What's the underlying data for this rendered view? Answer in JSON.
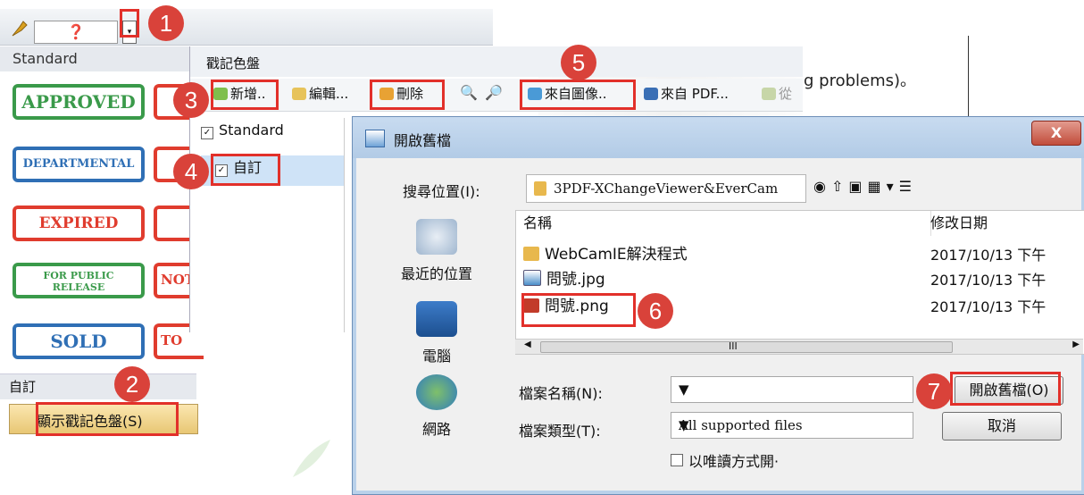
{
  "stamp_panel": {
    "standard_header": "Standard",
    "stamps": [
      "APPROVED",
      "DEPARTMENTAL",
      "EXPIRED",
      "FOR PUBLIC RELEASE",
      "SOLD"
    ],
    "stamp_colors": [
      "#3a9a4a",
      "#2f6fb5",
      "#e03c2e",
      "#3a9a4a",
      "#2f6fb5"
    ],
    "edge_texts": [
      "",
      "",
      "",
      "NOT",
      "TO"
    ],
    "custom_header": "自訂",
    "show_palette_button": "顯示戳記色盤(S)"
  },
  "palette_dialog": {
    "title": "戳記色盤",
    "toolbar": {
      "add": "新增..",
      "edit": "編輯...",
      "delete": "刪除",
      "from_image": "來自圖像..",
      "from_pdf": "來自 PDF...",
      "from_other": "從"
    },
    "list": {
      "standard": "Standard",
      "custom": "自訂"
    }
  },
  "document_text": "g problems)。",
  "open_dialog": {
    "title": "開啟舊檔",
    "look_in_label": "搜尋位置(I):",
    "look_in_value": "3PDF-XChangeViewer&EverCam",
    "places": [
      "最近的位置",
      "電腦",
      "網路"
    ],
    "columns": {
      "name": "名稱",
      "modified": "修改日期"
    },
    "files": [
      {
        "name": "WebCamIE解決程式",
        "date": "2017/10/13 下午",
        "type": "folder"
      },
      {
        "name": "問號.jpg",
        "date": "2017/10/13 下午",
        "type": "jpg"
      },
      {
        "name": "問號.png",
        "date": "2017/10/13 下午",
        "type": "png"
      }
    ],
    "scroll_mark": "III",
    "filename_label": "檔案名稱(N):",
    "filename_value": "",
    "filetype_label": "檔案類型(T):",
    "filetype_value": "All supported files",
    "readonly_label": "以唯讀方式開·",
    "open_button": "開啟舊檔(O)",
    "cancel_button": "取消",
    "close_glyph": "X"
  },
  "callouts": [
    "1",
    "2",
    "3",
    "4",
    "5",
    "6",
    "7"
  ]
}
